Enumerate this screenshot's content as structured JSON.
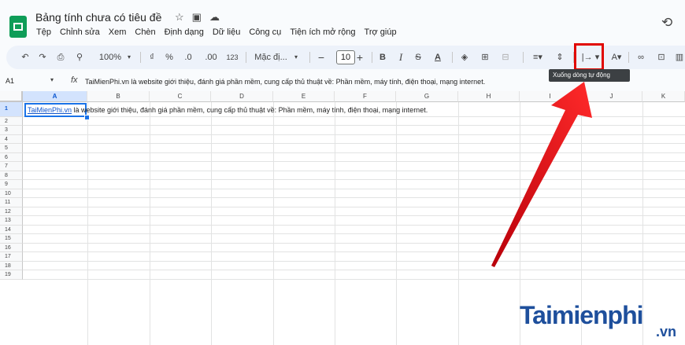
{
  "window": {
    "title": "Bảng tính chưa có tiêu đề"
  },
  "menu": [
    "Tệp",
    "Chỉnh sửa",
    "Xem",
    "Chèn",
    "Định dạng",
    "Dữ liệu",
    "Công cụ",
    "Tiện ích mở rộng",
    "Trợ giúp"
  ],
  "title_icons": [
    "star-icon",
    "folder-icon",
    "cloud-icon"
  ],
  "toolbar": {
    "zoom": "100%",
    "currency": "₫",
    "percent": "%",
    "dec_decrease": ".0",
    "dec_increase": ".00",
    "number_format": "123",
    "font": "Mặc đị...",
    "font_size": "10",
    "bold": "B",
    "italic": "I",
    "strike": "S",
    "text_color": "A",
    "link": "∞"
  },
  "tooltip": "Xuống dòng tự động",
  "formula_bar": {
    "name_box": "A1",
    "fx": "fx",
    "content": "TaiMienPhi.vn là website giới thiệu, đánh giá phần mềm, cung cấp thủ thuật về: Phần mềm, máy tính, điện thoại, mạng internet."
  },
  "grid": {
    "columns": [
      "A",
      "B",
      "C",
      "D",
      "E",
      "F",
      "G",
      "H",
      "I",
      "J",
      "K"
    ],
    "rows": [
      "1",
      "2",
      "3",
      "4",
      "5",
      "6",
      "7",
      "8",
      "9",
      "10",
      "11",
      "12",
      "13",
      "14",
      "15",
      "16",
      "17",
      "18",
      "19"
    ],
    "a1_link": "TaiMienPhi.vn",
    "a1_rest": " là website giới thiệu, đánh giá phần mềm, cung cấp thủ thuật về: Phần mềm, máy tính, điện thoại, mạng internet."
  },
  "watermark": {
    "brand": "Taimienphi",
    "suffix": ".vn"
  },
  "colors": {
    "highlight": "#e10600",
    "selection": "#1a73e8",
    "brand": "#1e4f9c"
  }
}
